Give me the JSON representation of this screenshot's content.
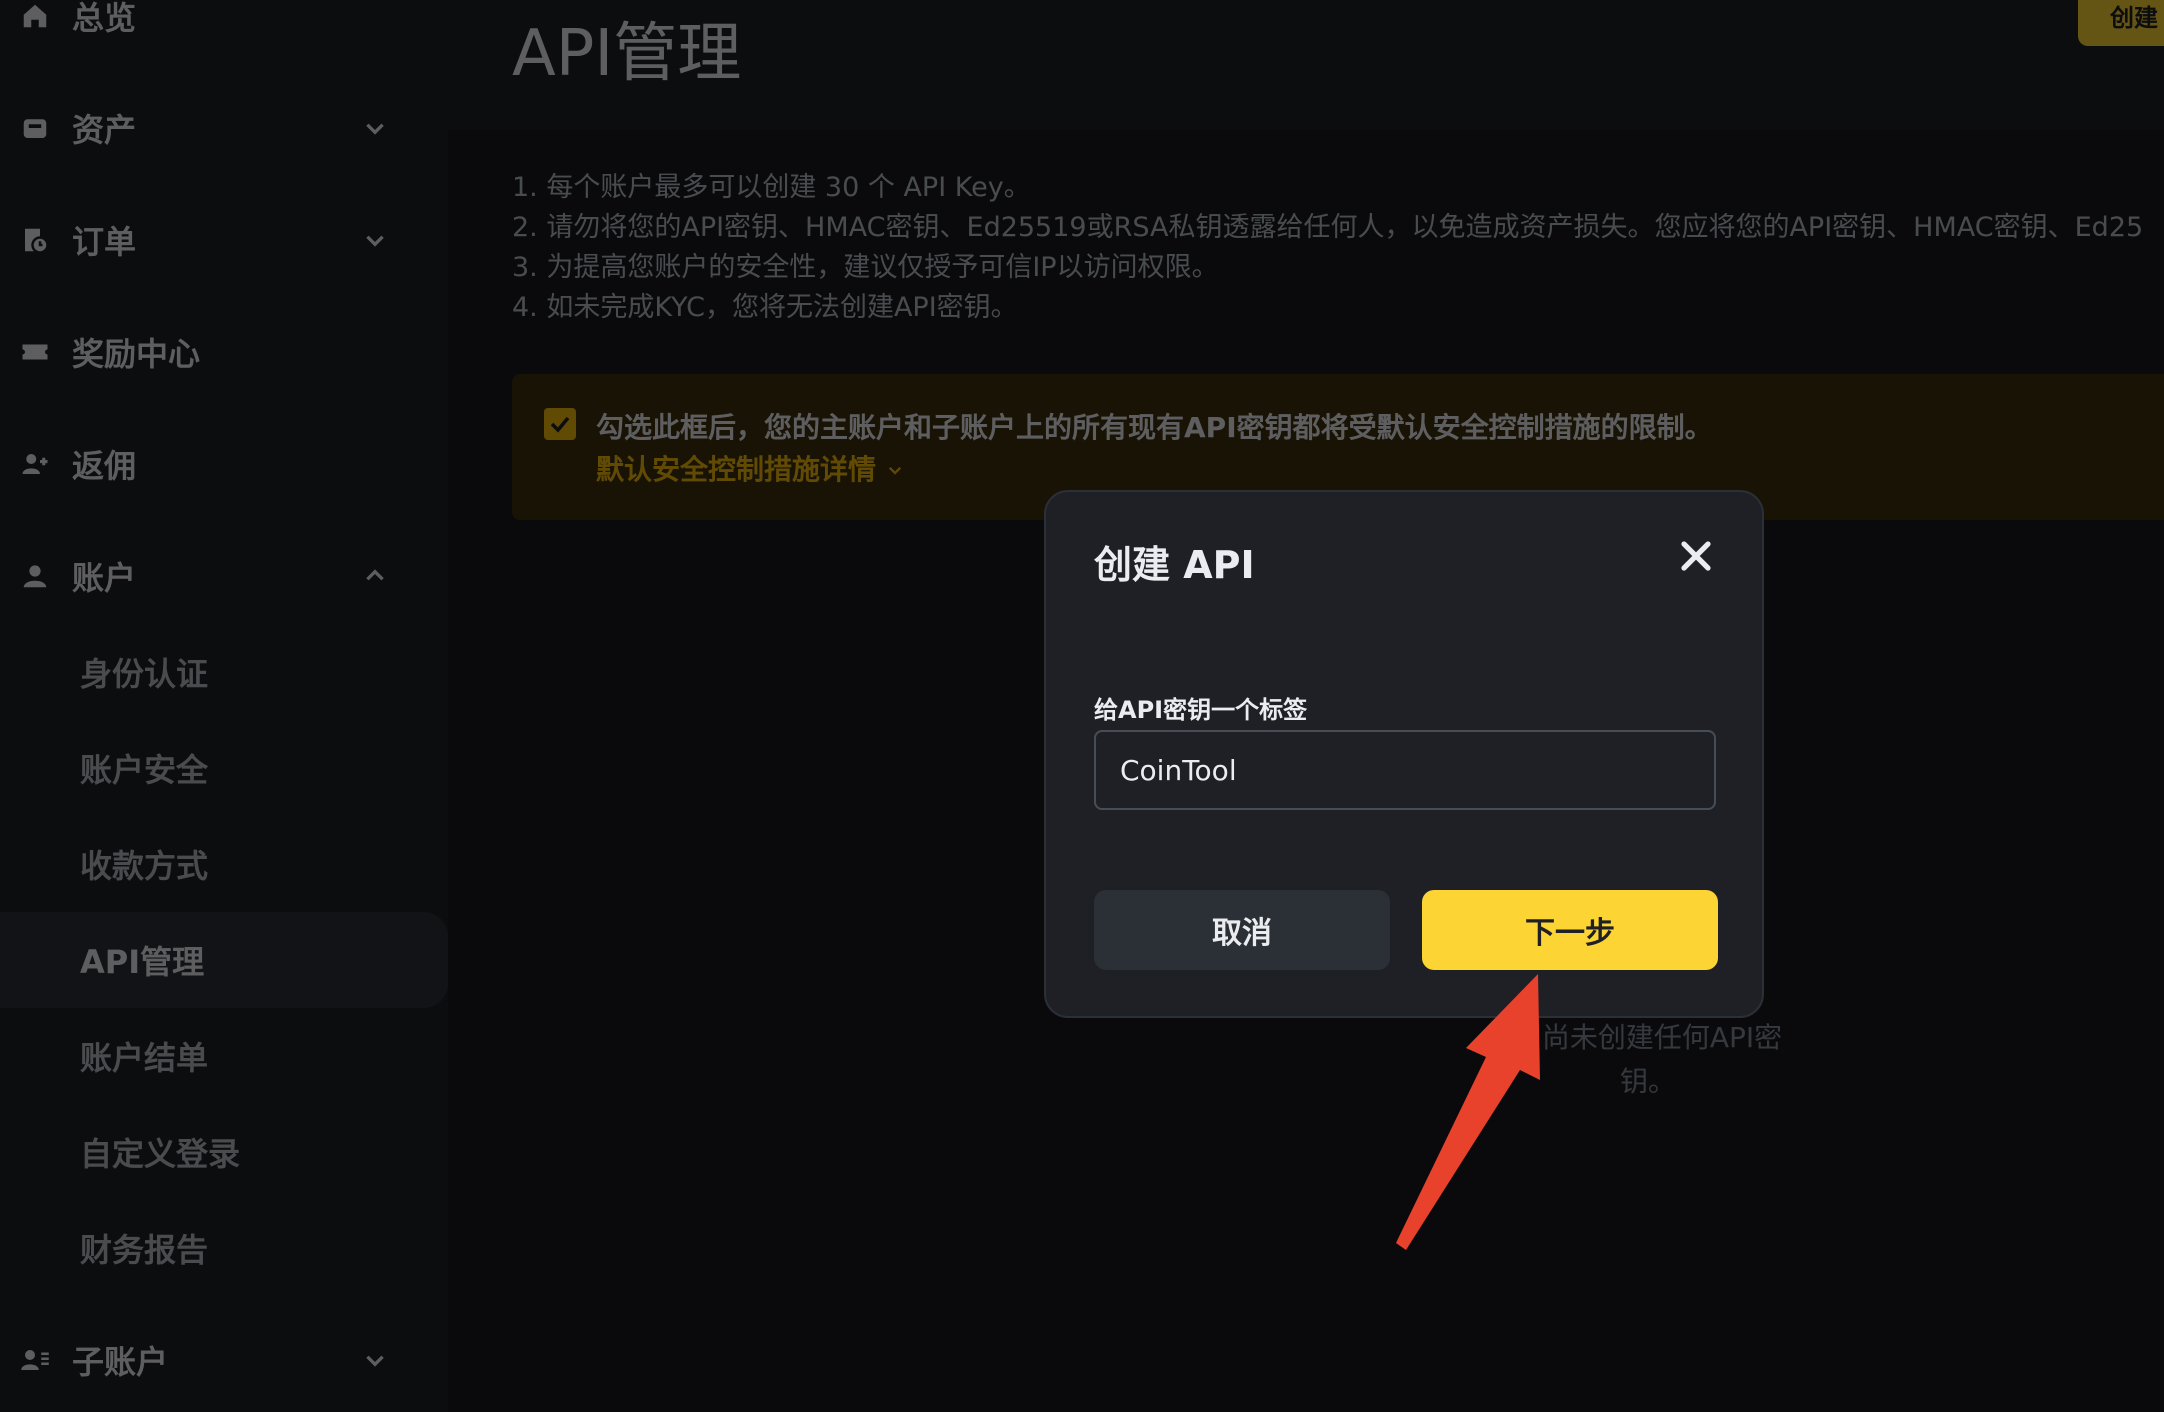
{
  "sidebar": {
    "items": [
      {
        "label": "总览",
        "icon": "home-icon"
      },
      {
        "label": "资产",
        "icon": "wallet-icon"
      },
      {
        "label": "订单",
        "icon": "order-icon"
      },
      {
        "label": "奖励中心",
        "icon": "ticket-icon"
      },
      {
        "label": "返佣",
        "icon": "add-user-icon"
      },
      {
        "label": "账户",
        "icon": "user-icon"
      }
    ],
    "sub_items": [
      {
        "label": "身份认证"
      },
      {
        "label": "账户安全"
      },
      {
        "label": "收款方式"
      },
      {
        "label": "API管理"
      },
      {
        "label": "账户结单"
      },
      {
        "label": "自定义登录"
      },
      {
        "label": "财务报告"
      }
    ],
    "sub_account": {
      "label": "子账户",
      "icon": "sub-account-icon"
    }
  },
  "header": {
    "title": "API管理",
    "create_button": "创建"
  },
  "notes": [
    "1. 每个账户最多可以创建 30 个 API Key。",
    "2. 请勿将您的API密钥、HMAC密钥、Ed25519或RSA私钥透露给任何人，以免造成资产损失。您应将您的API密钥、HMAC密钥、Ed25",
    "3. 为提高您账户的安全性，建议仅授予可信IP以访问权限。",
    "4. 如未完成KYC，您将无法创建API密钥。"
  ],
  "warning": {
    "text": "勾选此框后，您的主账户和子账户上的所有现有API密钥都将受默认安全控制措施的限制。",
    "link": "默认安全控制措施详情",
    "checked": true
  },
  "empty_state": {
    "line1": "户尚未创建任何API密",
    "line2": "钥。"
  },
  "modal": {
    "title": "创建 API",
    "field_label": "给API密钥一个标签",
    "field_value": "CoinTool",
    "cancel_label": "取消",
    "next_label": "下一步"
  },
  "colors": {
    "accent": "#fcd535",
    "annotation_arrow": "#e8412c",
    "background": "#181a20"
  }
}
